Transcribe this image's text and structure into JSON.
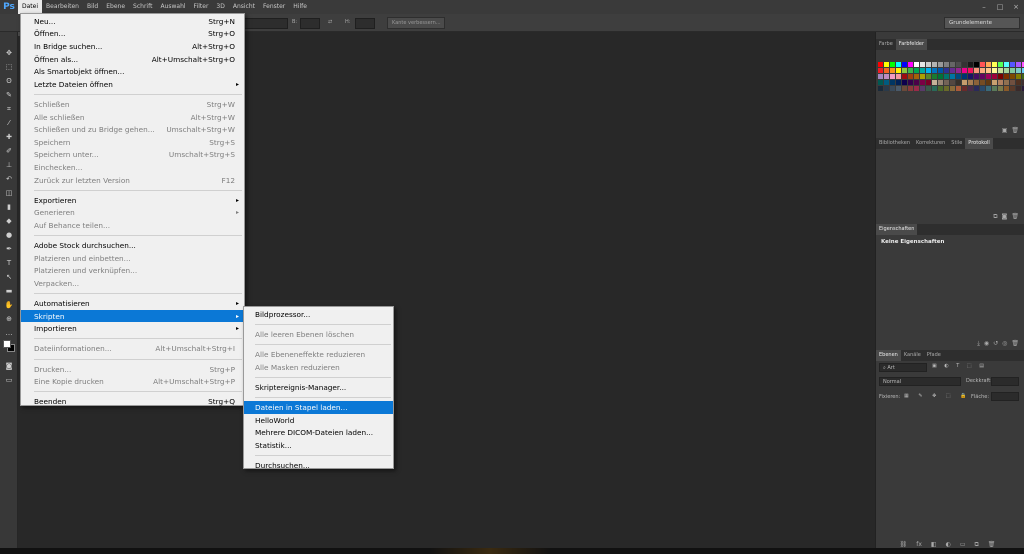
{
  "app": {
    "logo": "Ps"
  },
  "menubar": [
    {
      "label": "Datei",
      "active": true
    },
    {
      "label": "Bearbeiten"
    },
    {
      "label": "Bild"
    },
    {
      "label": "Ebene"
    },
    {
      "label": "Schrift"
    },
    {
      "label": "Auswahl"
    },
    {
      "label": "Filter"
    },
    {
      "label": "3D"
    },
    {
      "label": "Ansicht"
    },
    {
      "label": "Fenster"
    },
    {
      "label": "Hilfe"
    }
  ],
  "window_controls": [
    "–",
    "□",
    "×"
  ],
  "options_bar": {
    "b_label": "B:",
    "h_label": "H:",
    "refine_button": "Kante verbessern...",
    "workspace": "Grundelemente"
  },
  "file_menu": [
    {
      "label": "Neu...",
      "shortcut": "Strg+N"
    },
    {
      "label": "Öffnen...",
      "shortcut": "Strg+O"
    },
    {
      "label": "In Bridge suchen...",
      "shortcut": "Alt+Strg+O"
    },
    {
      "label": "Öffnen als...",
      "shortcut": "Alt+Umschalt+Strg+O"
    },
    {
      "label": "Als Smartobjekt öffnen..."
    },
    {
      "label": "Letzte Dateien öffnen",
      "submenu": true
    },
    {
      "separator": true
    },
    {
      "label": "Schließen",
      "shortcut": "Strg+W",
      "disabled": true
    },
    {
      "label": "Alle schließen",
      "shortcut": "Alt+Strg+W",
      "disabled": true
    },
    {
      "label": "Schließen und zu Bridge gehen...",
      "shortcut": "Umschalt+Strg+W",
      "disabled": true
    },
    {
      "label": "Speichern",
      "shortcut": "Strg+S",
      "disabled": true
    },
    {
      "label": "Speichern unter...",
      "shortcut": "Umschalt+Strg+S",
      "disabled": true
    },
    {
      "label": "Einchecken...",
      "disabled": true
    },
    {
      "label": "Zurück zur letzten Version",
      "shortcut": "F12",
      "disabled": true
    },
    {
      "separator": true
    },
    {
      "label": "Exportieren",
      "submenu": true
    },
    {
      "label": "Generieren",
      "submenu": true,
      "disabled": true
    },
    {
      "label": "Auf Behance teilen...",
      "disabled": true
    },
    {
      "separator": true
    },
    {
      "label": "Adobe Stock durchsuchen..."
    },
    {
      "label": "Platzieren und einbetten...",
      "disabled": true
    },
    {
      "label": "Platzieren und verknüpfen...",
      "disabled": true
    },
    {
      "label": "Verpacken...",
      "disabled": true
    },
    {
      "separator": true
    },
    {
      "label": "Automatisieren",
      "submenu": true
    },
    {
      "label": "Skripten",
      "submenu": true,
      "highlighted": true
    },
    {
      "label": "Importieren",
      "submenu": true
    },
    {
      "separator": true
    },
    {
      "label": "Dateiinformationen...",
      "shortcut": "Alt+Umschalt+Strg+I",
      "disabled": true
    },
    {
      "separator": true
    },
    {
      "label": "Drucken...",
      "shortcut": "Strg+P",
      "disabled": true
    },
    {
      "label": "Eine Kopie drucken",
      "shortcut": "Alt+Umschalt+Strg+P",
      "disabled": true
    },
    {
      "separator": true
    },
    {
      "label": "Beenden",
      "shortcut": "Strg+Q"
    }
  ],
  "scripts_submenu": [
    {
      "label": "Bildprozessor..."
    },
    {
      "separator": true
    },
    {
      "label": "Alle leeren Ebenen löschen",
      "disabled": true
    },
    {
      "separator": true
    },
    {
      "label": "Alle Ebeneneffekte reduzieren",
      "disabled": true
    },
    {
      "label": "Alle Masken reduzieren",
      "disabled": true
    },
    {
      "separator": true
    },
    {
      "label": "Skriptereignis-Manager..."
    },
    {
      "separator": true
    },
    {
      "label": "Dateien in Stapel laden...",
      "highlighted": true
    },
    {
      "label": "HelloWorld"
    },
    {
      "label": "Mehrere DICOM-Dateien laden..."
    },
    {
      "label": "Statistik..."
    },
    {
      "separator": true
    },
    {
      "label": "Durchsuchen..."
    }
  ],
  "panels": {
    "color": {
      "tabs": [
        "Farbe",
        "Farbfelder"
      ],
      "active": 1
    },
    "history": {
      "tabs": [
        "Bibliotheken",
        "Korrekturen",
        "Stile",
        "Protokoll"
      ],
      "active": 3
    },
    "properties": {
      "tabs": [
        "Eigenschaften"
      ],
      "active": 0,
      "message": "Keine Eigenschaften"
    },
    "layers": {
      "tabs": [
        "Ebenen",
        "Kanäle",
        "Pfade"
      ],
      "active": 0,
      "filter": "Art",
      "blend": "Normal",
      "opacity_label": "Deckkraft:",
      "lock_label": "Fixieren:",
      "fill_label": "Fläche:"
    }
  },
  "colors": {
    "accent": "#0b78d6",
    "menu_bg": "#f0f0f0",
    "canvas": "#282828"
  }
}
